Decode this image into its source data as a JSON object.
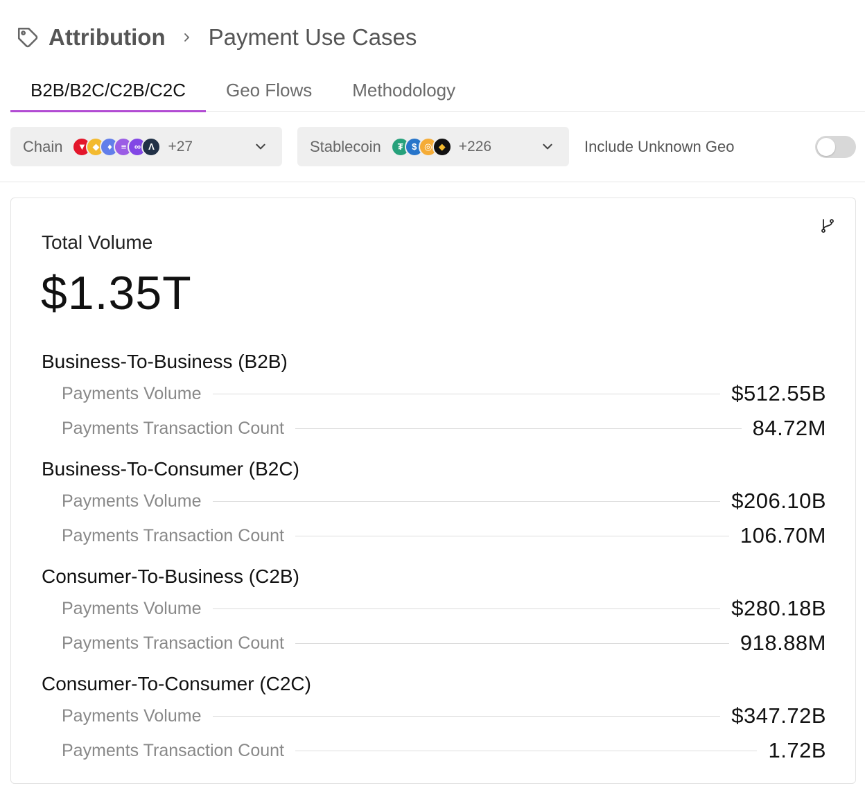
{
  "breadcrumb": {
    "root": "Attribution",
    "current": "Payment Use Cases"
  },
  "tabs": [
    {
      "label": "B2B/B2C/C2B/C2C",
      "active": true
    },
    {
      "label": "Geo Flows",
      "active": false
    },
    {
      "label": "Methodology",
      "active": false
    }
  ],
  "filters": {
    "chain": {
      "label": "Chain",
      "icons": [
        "tron-icon",
        "bnb-icon",
        "ethereum-icon",
        "solana-icon",
        "polygon-icon",
        "arbitrum-icon"
      ],
      "more": "+27"
    },
    "stablecoin": {
      "label": "Stablecoin",
      "icons": [
        "usdt-icon",
        "usdc-icon",
        "dai-icon",
        "bnb-stable-icon"
      ],
      "more": "+226"
    },
    "unknown_geo": {
      "label": "Include Unknown Geo",
      "enabled": false
    }
  },
  "summary": {
    "total_label": "Total Volume",
    "total_value": "$1.35T"
  },
  "sections": [
    {
      "title": "Business-To-Business (B2B)",
      "volume_label": "Payments Volume",
      "volume_value": "$512.55B",
      "count_label": "Payments Transaction Count",
      "count_value": "84.72M"
    },
    {
      "title": "Business-To-Consumer (B2C)",
      "volume_label": "Payments Volume",
      "volume_value": "$206.10B",
      "count_label": "Payments Transaction Count",
      "count_value": "106.70M"
    },
    {
      "title": "Consumer-To-Business (C2B)",
      "volume_label": "Payments Volume",
      "volume_value": "$280.18B",
      "count_label": "Payments Transaction Count",
      "count_value": "918.88M"
    },
    {
      "title": "Consumer-To-Consumer (C2C)",
      "volume_label": "Payments Volume",
      "volume_value": "$347.72B",
      "count_label": "Payments Transaction Count",
      "count_value": "1.72B"
    }
  ],
  "colors": {
    "accent": "#b24bd3",
    "tron": "#e3162b",
    "bnb": "#f3ba2f",
    "ethereum": "#627eea",
    "solana": "#9b5de5",
    "polygon": "#8247e5",
    "arbitrum": "#213147",
    "usdt": "#26a17b",
    "usdc": "#2775ca",
    "dai": "#f5ac37",
    "bnb_stable": "#111111"
  }
}
